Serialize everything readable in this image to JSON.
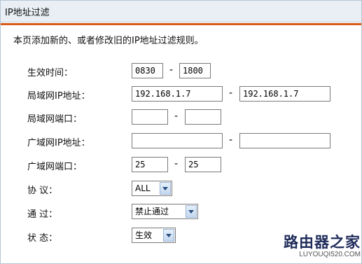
{
  "header": {
    "title": "IP地址过滤"
  },
  "description": "本页添加新的、或者修改旧的IP地址过滤规则。",
  "form": {
    "effective_time": {
      "label": "生效时间：",
      "start": "0830",
      "end": "1800"
    },
    "lan_ip": {
      "label": "局域网IP地址：",
      "start": "192.168.1.7",
      "end": "192.168.1.7"
    },
    "lan_port": {
      "label": "局域网端口：",
      "start": "",
      "end": ""
    },
    "wan_ip": {
      "label": "广域网IP地址：",
      "start": "",
      "end": ""
    },
    "wan_port": {
      "label": "广域网端口：",
      "start": "25",
      "end": "25"
    },
    "protocol": {
      "label": "协 议：",
      "value": "ALL"
    },
    "pass": {
      "label": "通 过：",
      "value": "禁止通过"
    },
    "status": {
      "label": "状 态：",
      "value": "生效"
    },
    "range_separator": "-"
  },
  "watermark": {
    "text": "路由器之家",
    "url": "LUYOUQI520.COM"
  },
  "colors": {
    "accent_rule": "#d95b1a",
    "header_bg": "#e9eff5"
  }
}
